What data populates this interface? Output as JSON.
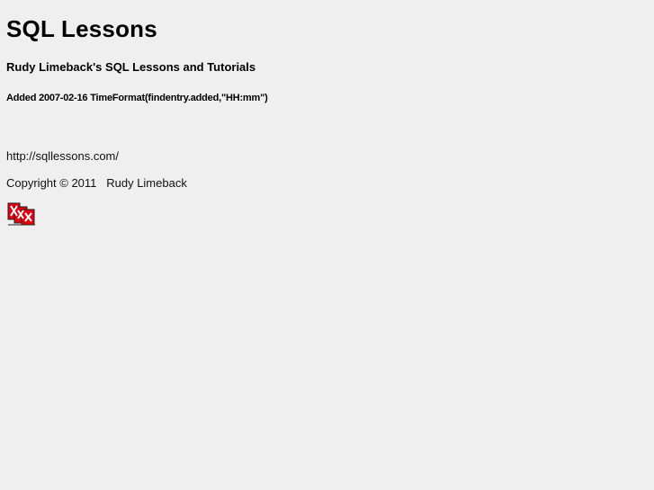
{
  "page": {
    "title": "SQL Lessons",
    "subtitle": "Rudy Limeback's SQL Lessons and Tutorials",
    "added_line": "Added 2007-02-16 TimeFormat(findentry.added,\"HH:mm\")",
    "url_text": "http://sqllessons.com/",
    "copyright_text": "Copyright © 2011   Rudy Limeback"
  },
  "logo": {
    "icon": "red-logo-icon",
    "colors": {
      "red": "#e3000f",
      "white": "#ffffff",
      "dark": "#222222"
    }
  }
}
